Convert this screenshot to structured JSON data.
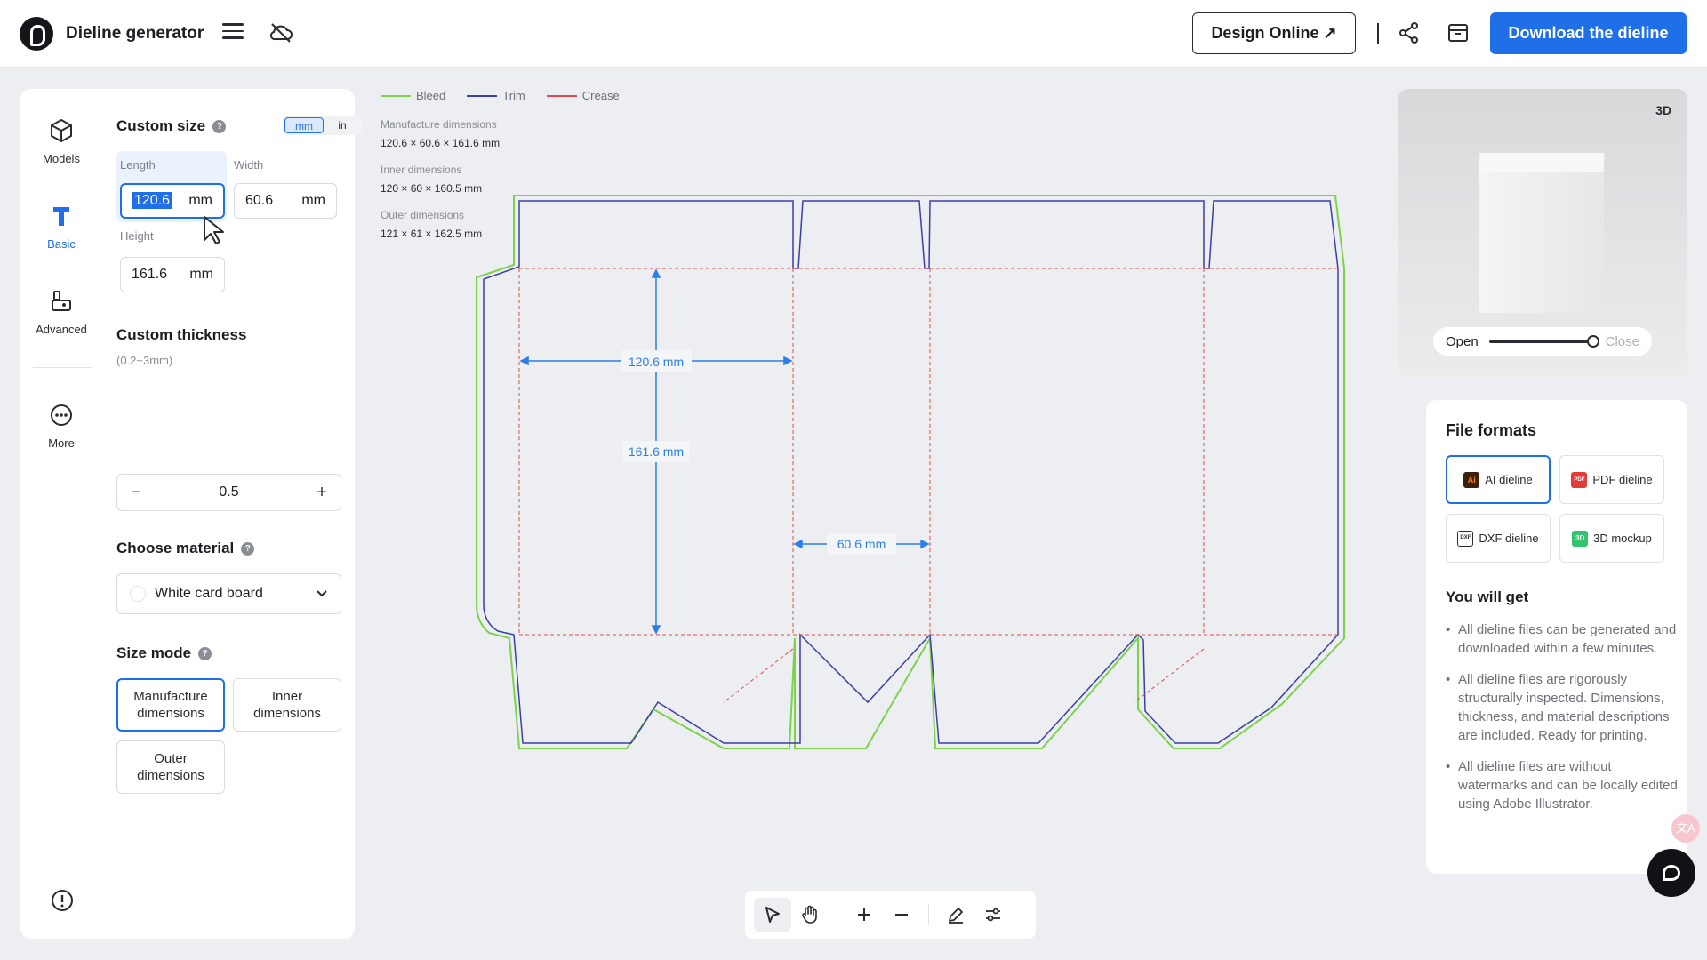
{
  "header": {
    "app_title": "Dieline generator",
    "design_online_label": "Design Online ↗",
    "download_label": "Download the dieline"
  },
  "sidebar": {
    "items": [
      {
        "label": "Models",
        "icon": "cube-icon"
      },
      {
        "label": "Basic",
        "icon": "text-t-icon"
      },
      {
        "label": "Advanced",
        "icon": "advanced-icon"
      },
      {
        "label": "More",
        "icon": "more-dots-icon"
      }
    ]
  },
  "form": {
    "custom_size_title": "Custom size",
    "unit_mm": "mm",
    "unit_in": "in",
    "length_label": "Length",
    "length_value": "120.6",
    "width_label": "Width",
    "width_value": "60.6",
    "height_label": "Height",
    "height_value": "161.6",
    "unit_suffix": "mm",
    "thickness_title": "Custom thickness",
    "thickness_hint": "(0.2~3mm)",
    "thickness_value": "0.5",
    "material_title": "Choose material",
    "material_value": "White card board",
    "size_mode_title": "Size mode",
    "mode_manufacture": "Manufacture dimensions",
    "mode_inner": "Inner dimensions",
    "mode_outer": "Outer dimensions"
  },
  "canvas": {
    "legend": [
      {
        "label": "Bleed",
        "color": "#7cd24a"
      },
      {
        "label": "Trim",
        "color": "#3a3fa6"
      },
      {
        "label": "Crease",
        "color": "#e24a4a"
      }
    ],
    "manufacture_label": "Manufacture dimensions",
    "manufacture_value": "120.6 × 60.6 × 161.6 mm",
    "inner_label": "Inner dimensions",
    "inner_value": "120 × 60 × 160.5 mm",
    "outer_label": "Outer dimensions",
    "outer_value": "121 × 61 × 162.5 mm",
    "dim_length": "120.6 mm",
    "dim_height": "161.6 mm",
    "dim_width": "60.6 mm"
  },
  "preview": {
    "btn_3d": "3D",
    "open_label": "Open",
    "close_label": "Close",
    "openness": 1.0
  },
  "formats": {
    "title": "File formats",
    "items": [
      {
        "label": "AI dieline",
        "badge": "Ai",
        "color": "#f07c1b"
      },
      {
        "label": "PDF dieline",
        "badge": "PDF",
        "color": "#e23b3b"
      },
      {
        "label": "DXF dieline",
        "badge": "DXF",
        "color": "#2a2b30"
      },
      {
        "label": "3D mockup",
        "badge": "3D",
        "color": "#34c36f"
      }
    ],
    "you_will_get_title": "You will get",
    "bullets": [
      "All dieline files can be generated and downloaded within a few minutes.",
      "All dieline files are rigorously structurally inspected. Dimensions, thickness, and material descriptions are included. Ready for printing.",
      "All dieline files are without watermarks and can be locally edited using Adobe Illustrator."
    ]
  },
  "colors": {
    "accent": "#1f6fe8",
    "bleed": "#7cd24a",
    "trim": "#3a3fa6",
    "crease": "#e24a4a"
  }
}
